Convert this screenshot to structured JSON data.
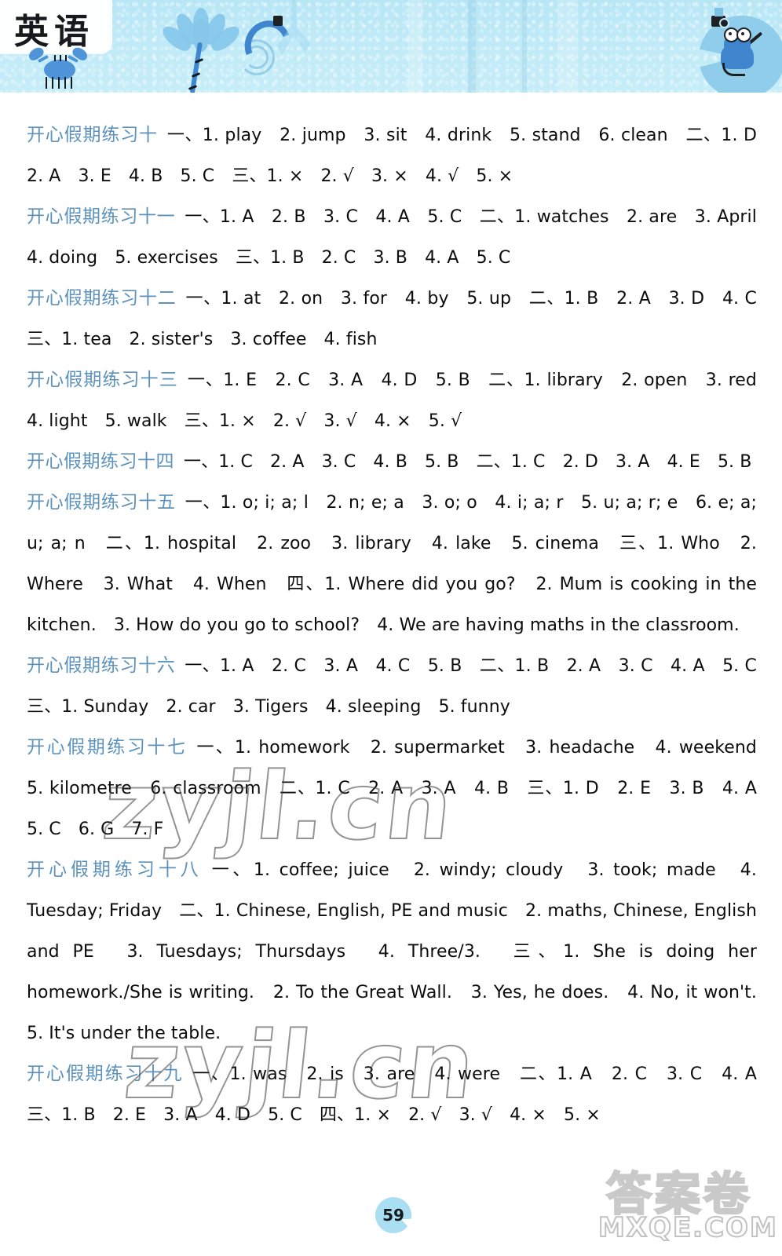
{
  "header": {
    "subject_label": "英语",
    "icons": [
      "crab-icon",
      "lotus-flower-icon",
      "water-hose-icon",
      "frog-selfie-icon",
      "lily-pad-icon"
    ],
    "banner_color": "#bfeaf7",
    "plate_color": "#fdfefe"
  },
  "page": {
    "number": "59",
    "badge_color": "#a9def3",
    "heading_color": "#5c92bb",
    "text_color": "#0c0c0c"
  },
  "watermarks": {
    "center_1": "zyjl.cn",
    "center_2": "zyjl.cn",
    "corner_cn": "答案卷",
    "corner_site": "MXQE.COM"
  },
  "exercises": [
    {
      "title": "开心假期练习十",
      "body": "一、1. play　2. jump　3. sit　4. drink　5. stand　6. clean　二、1. D　2. A　3. E　4. B　5. C　三、1. ×　2. √　3. ×　4. √　5. ×"
    },
    {
      "title": "开心假期练习十一",
      "body": "一、1. A　2. B　3. C　4. A　5. C　二、1. watches　2. are　3. April　4. doing　5. exercises　三、1. B　2. C　3. B　4. A　5. C"
    },
    {
      "title": "开心假期练习十二",
      "body": "一、1. at　2. on　3. for　4. by　5. up　二、1. B　2. A　3. D　4. C　三、1. tea　2. sister's　3. coffee　4. fish"
    },
    {
      "title": "开心假期练习十三",
      "body": "一、1. E　2. C　3. A　4. D　5. B　二、1. library　2. open　3. red　4. light　5. walk　三、1. ×　2. √　3. √　4. ×　5. √"
    },
    {
      "title": "开心假期练习十四",
      "body": "一、1. C　2. A　3. C　4. B　5. B　二、1. C　2. D　3. A　4. E　5. B"
    },
    {
      "title": "开心假期练习十五",
      "body": "一、1. o; i; a; l　2. n; e; a　3. o; o　4. i; a; r　5. u; a; r; e　6. e; a; u; a; n　二、1. hospital　2. zoo　3. library　4. lake　5. cinema　三、1. Who　2. Where　3. What　4. When　四、1. Where did you go?　2. Mum is cooking in the kitchen.　3. How do you go to school?　4. We are having maths in the classroom."
    },
    {
      "title": "开心假期练习十六",
      "body": "一、1. A　2. C　3. A　4. C　5. B　二、1. B　2. A　3. C　4. A　5. C　三、1. Sunday　2. car　3. Tigers　4. sleeping　5. funny"
    },
    {
      "title": "开心假期练习十七",
      "body": "一、1. homework　2. supermarket　3. headache　4. weekend　5. kilometre　6. classroom　二、1. C　2. A　3. A　4. B　三、1. D　2. E　3. B　4. A　5. C　6. G　7. F"
    },
    {
      "title": "开心假期练习十八",
      "body": "一、1. coffee; juice　2. windy; cloudy　3. took; made　4. Tuesday; Friday　二、1. Chinese, English, PE and music　2. maths, Chinese, English and PE　3. Tuesdays; Thursdays　4. Three/3.　三、1. She is doing her homework./She is writing.　2. To the Great Wall.　3. Yes, he does.　4. No, it won't.　5. It's under the table."
    },
    {
      "title": "开心假期练习十九",
      "body": "一、1. was　2. is　3. are　4. were　二、1. A　2. C　3. C　4. A　三、1. B　2. E　3. A　4. D　5. C　四、1. ×　2. √　3. √　4. ×　5. ×"
    }
  ]
}
